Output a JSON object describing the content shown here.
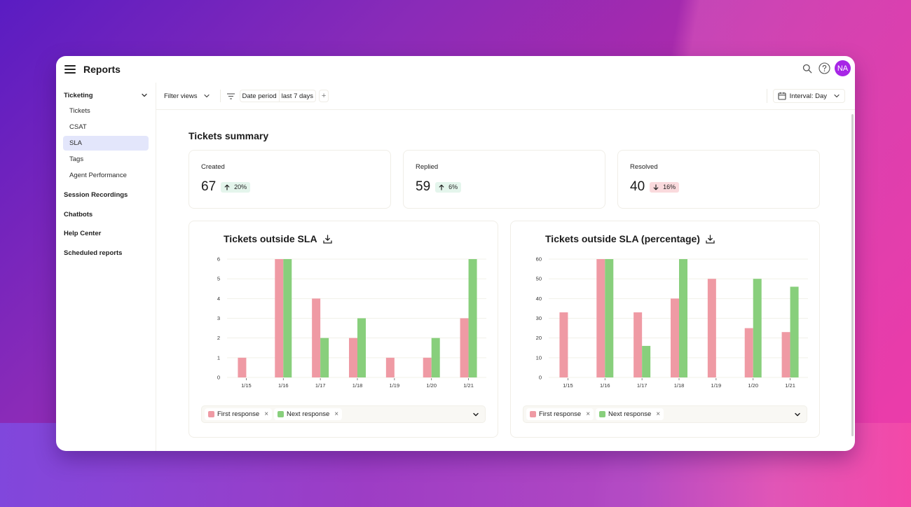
{
  "app": {
    "title": "Reports",
    "avatar_initials": "NA",
    "icons": {
      "menu": "hamburger-icon",
      "search": "search-icon",
      "help": "help-icon"
    },
    "colors": {
      "avatar": "#a726e6",
      "active_nav": "#e3e6fb",
      "first_response": "#ef9aa4",
      "next_response": "#88cf7c",
      "badge_up": "#e4f5ec",
      "badge_down": "#fadadd"
    }
  },
  "sidebar": {
    "group": {
      "label": "Ticketing",
      "expanded": true
    },
    "items": [
      {
        "label": "Tickets",
        "active": false
      },
      {
        "label": "CSAT",
        "active": false
      },
      {
        "label": "SLA",
        "active": true
      },
      {
        "label": "Tags",
        "active": false
      },
      {
        "label": "Agent Performance",
        "active": false
      }
    ],
    "sections": [
      {
        "label": "Session Recordings"
      },
      {
        "label": "Chatbots"
      },
      {
        "label": "Help Center"
      },
      {
        "label": "Scheduled reports"
      }
    ]
  },
  "filterbar": {
    "filter_views_label": "Filter views",
    "date_period_label": "Date period",
    "date_period_value": "last 7 days",
    "add_filter_label": "+",
    "interval_label": "Interval: Day"
  },
  "summary": {
    "title": "Tickets summary",
    "cards": [
      {
        "label": "Created",
        "value": "67",
        "change": "20%",
        "direction": "up"
      },
      {
        "label": "Replied",
        "value": "59",
        "change": "6%",
        "direction": "up"
      },
      {
        "label": "Resolved",
        "value": "40",
        "change": "16%",
        "direction": "down"
      }
    ]
  },
  "legend": {
    "items": [
      {
        "label": "First response",
        "color": "#ef9aa4"
      },
      {
        "label": "Next response",
        "color": "#88cf7c"
      }
    ],
    "remove_glyph": "×"
  },
  "chart_data": [
    {
      "type": "bar",
      "title": "Tickets outside SLA",
      "xlabel": "",
      "ylabel": "",
      "categories": [
        "1/15",
        "1/16",
        "1/17",
        "1/18",
        "1/19",
        "1/20",
        "1/21"
      ],
      "yticks": [
        0,
        1,
        2,
        3,
        4,
        5,
        6
      ],
      "ylim": [
        0,
        6
      ],
      "grid": true,
      "legend_position": "bottom",
      "series": [
        {
          "name": "First response",
          "color": "#ef9aa4",
          "values": [
            1,
            6,
            4,
            2,
            1,
            1,
            3
          ]
        },
        {
          "name": "Next response",
          "color": "#88cf7c",
          "values": [
            0,
            6,
            2,
            3,
            0,
            2,
            6
          ]
        }
      ]
    },
    {
      "type": "bar",
      "title": "Tickets outside SLA (percentage)",
      "xlabel": "",
      "ylabel": "",
      "categories": [
        "1/15",
        "1/16",
        "1/17",
        "1/18",
        "1/19",
        "1/20",
        "1/21"
      ],
      "yticks": [
        0,
        10,
        20,
        30,
        40,
        50,
        60
      ],
      "ylim": [
        0,
        60
      ],
      "grid": true,
      "legend_position": "bottom",
      "series": [
        {
          "name": "First response",
          "color": "#ef9aa4",
          "values": [
            33,
            60,
            33,
            40,
            50,
            25,
            23
          ]
        },
        {
          "name": "Next response",
          "color": "#88cf7c",
          "values": [
            0,
            60,
            16,
            60,
            0,
            50,
            46
          ]
        }
      ]
    }
  ]
}
